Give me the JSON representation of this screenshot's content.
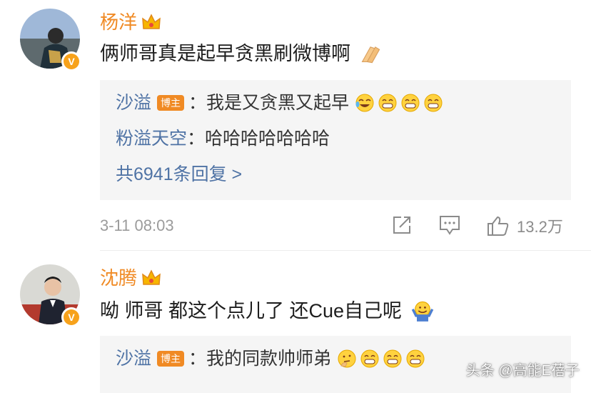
{
  "colors": {
    "name": "#f08a24",
    "link": "#4f73a5",
    "badge": "#f08a24",
    "meta": "#9b9b9b",
    "reply_bg": "#f5f5f5"
  },
  "comments": [
    {
      "name": "杨洋",
      "text": "俩师哥真是起早贪黑刷微博啊",
      "text_emoji": "clap-hands-emoji",
      "replies": [
        {
          "name": "沙溢",
          "badge": "博主",
          "sep": "：",
          "text": "我是又贪黑又起早",
          "emojis": [
            "laugh-cry-emoji",
            "grin-emoji",
            "grin-emoji",
            "grin-emoji"
          ]
        },
        {
          "name": "粉溢天空",
          "sep": "：",
          "text": "哈哈哈哈哈哈哈"
        }
      ],
      "more": "共6941条回复 >",
      "time": "3-11 08:03",
      "likes": "13.2万"
    },
    {
      "name": "沈腾",
      "text": "呦 师哥 都这个点儿了 还Cue自己呢",
      "text_emoji": "shrug-emoji",
      "replies": [
        {
          "name": "沙溢",
          "badge": "博主",
          "sep": "：",
          "text": "我的同款帅师弟",
          "emojis": [
            "thinking-emoji",
            "grin-emoji",
            "grin-emoji",
            "grin-emoji"
          ]
        }
      ]
    }
  ],
  "watermark": "头条 @高能E蓓子"
}
